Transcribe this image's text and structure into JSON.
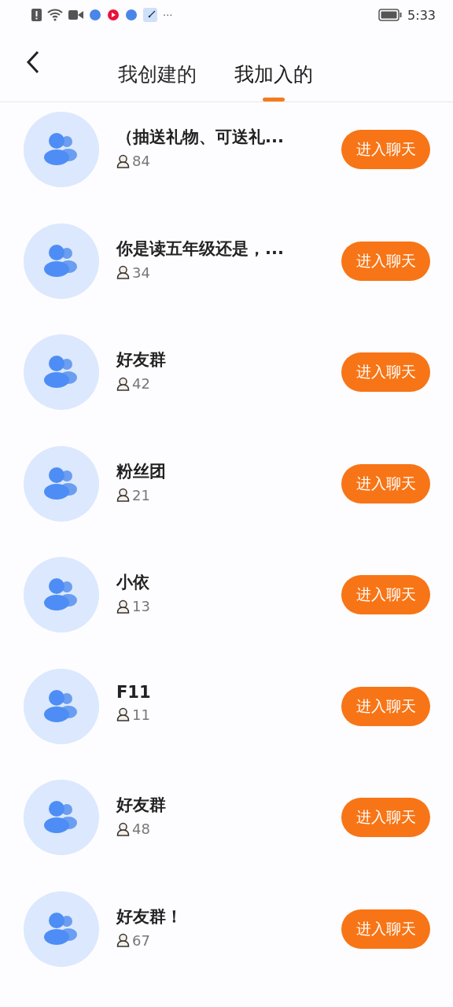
{
  "status_bar": {
    "time": "5:33",
    "more": "···"
  },
  "tabs": [
    {
      "label": "我创建的",
      "selected": false
    },
    {
      "label": "我加入的",
      "selected": true
    }
  ],
  "groups": [
    {
      "name": "（抽送礼物、可送礼...",
      "members": "84",
      "button": "进入聊天"
    },
    {
      "name": "你是读五年级还是，...",
      "members": "34",
      "button": "进入聊天"
    },
    {
      "name": "好友群",
      "members": "42",
      "button": "进入聊天"
    },
    {
      "name": "粉丝团",
      "members": "21",
      "button": "进入聊天"
    },
    {
      "name": "小依",
      "members": "13",
      "button": "进入聊天"
    },
    {
      "name": "F11",
      "members": "11",
      "button": "进入聊天"
    },
    {
      "name": "好友群",
      "members": "48",
      "button": "进入聊天"
    },
    {
      "name": "好友群！",
      "members": "67",
      "button": "进入聊天"
    }
  ]
}
